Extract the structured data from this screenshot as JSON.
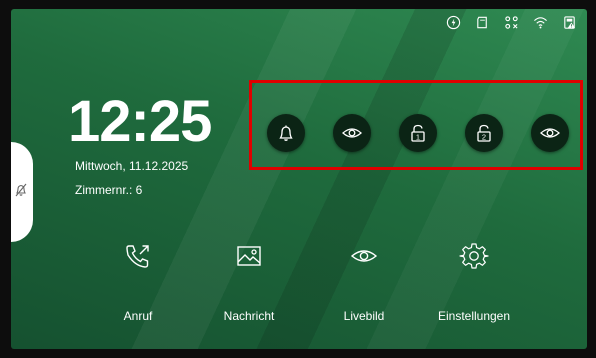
{
  "status_icons": [
    "power-icon",
    "sd-card-icon",
    "network-off-icon",
    "wifi-icon",
    "battery-warning-icon"
  ],
  "clock": {
    "time": "12:25"
  },
  "info": {
    "date": "Mittwoch, 11.12.2025",
    "room": "Zimmernr.: 6"
  },
  "side_tab": {
    "icon": "mute-bell-icon"
  },
  "quick_actions": [
    {
      "icon": "bell-icon"
    },
    {
      "icon": "eye-icon"
    },
    {
      "icon": "unlock-1-icon",
      "badge": "1"
    },
    {
      "icon": "unlock-2-icon",
      "badge": "2"
    },
    {
      "icon": "eye-icon"
    }
  ],
  "menu": [
    {
      "icon": "phone-call-icon",
      "label": "Anruf"
    },
    {
      "icon": "image-icon",
      "label": "Nachricht"
    },
    {
      "icon": "eye-icon",
      "label": "Livebild"
    },
    {
      "icon": "gear-icon",
      "label": "Einstellungen"
    }
  ],
  "colors": {
    "highlight": "#e00000",
    "background": "#1f6b3d",
    "button": "#0b2415"
  }
}
